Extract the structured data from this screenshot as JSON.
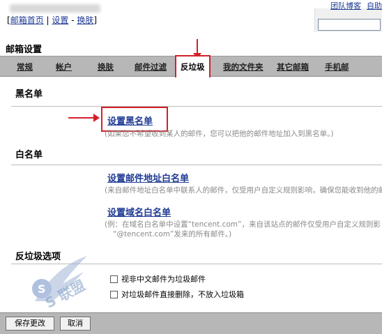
{
  "header": {
    "breadcrumb_open": "[",
    "breadcrumb_home": "邮箱首页",
    "breadcrumb_sep1": " | ",
    "breadcrumb_settings": "设置",
    "breadcrumb_sep2": " - ",
    "breadcrumb_skin": "换肤",
    "breadcrumb_close": "]",
    "top_link_1": "团队博客",
    "top_link_2": "自助"
  },
  "page_title": "邮箱设置",
  "tabs": [
    {
      "label": "常规"
    },
    {
      "label": "帐户"
    },
    {
      "label": "换肤"
    },
    {
      "label": "邮件过滤"
    },
    {
      "label": "反垃圾"
    },
    {
      "label": "我的文件夹"
    },
    {
      "label": "其它邮箱"
    },
    {
      "label": "手机邮"
    }
  ],
  "blacklist": {
    "heading": "黑名单",
    "link": "设置黑名单",
    "hint": "(如果您不希望收到某人的邮件，您可以把他的邮件地址加入到黑名单。)"
  },
  "whitelist": {
    "heading": "白名单",
    "address_link": "设置邮件地址白名单",
    "address_hint": "(来自邮件地址白名单中联系人的邮件，仅受用户自定义规则影响，确保您能收到他的邮件)",
    "domain_link": "设置域名白名单",
    "domain_hint_1": "(例：在域名白名单中设置“tencent.com”，来自该站点的邮件仅受用户自定义规则影",
    "domain_hint_2": "“@tencent.com”发来的所有邮件。)"
  },
  "antispam": {
    "heading": "反垃圾选项",
    "option_1": "视非中文邮件为垃圾邮件",
    "option_2": "对垃圾邮件直接删除，不放入垃圾箱"
  },
  "footer": {
    "save_label": "保存更改",
    "cancel_label": "取消"
  },
  "watermark": {
    "text": "S 联盟"
  },
  "colors": {
    "accent_red": "#d4202a",
    "link_blue": "#1f3a93",
    "bar_gray": "#b7b7b7"
  }
}
